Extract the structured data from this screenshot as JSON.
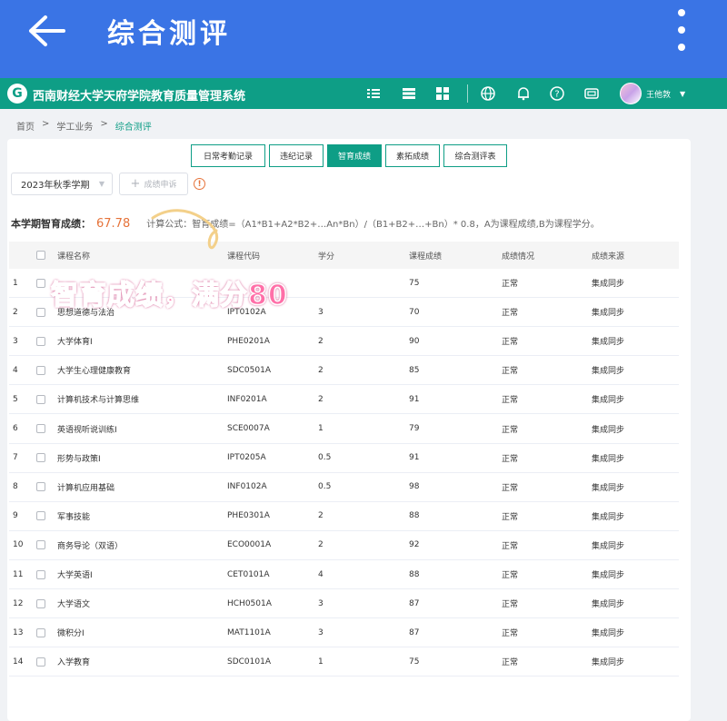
{
  "appbar": {
    "back_icon": "back-arrow-icon",
    "title": "综合测评",
    "menu_icon": "more-vertical-icon"
  },
  "header": {
    "logo_icon": "school-logo-icon",
    "system_name": "西南财经大学天府学院教育质量管理系统",
    "icons": [
      "list-indent-icon",
      "list-icon",
      "grid-icon",
      "globe-icon",
      "bell-icon",
      "help-icon",
      "badge-icon"
    ],
    "user_name": "王他敦",
    "accent_color": "#0e9e86"
  },
  "breadcrumb": {
    "home": "首页",
    "sep": ">",
    "level1": "学工业务",
    "current": "综合测评"
  },
  "tabs": [
    {
      "label": "日常考勤记录",
      "active": false
    },
    {
      "label": "违纪记录",
      "active": false
    },
    {
      "label": "智育成绩",
      "active": true
    },
    {
      "label": "素拓成绩",
      "active": false
    },
    {
      "label": "综合测评表",
      "active": false
    }
  ],
  "toolbar": {
    "semester": "2023年秋季学期",
    "apply_label": "成绩申诉",
    "apply_icon": "plus-icon",
    "info_icon": "info-icon"
  },
  "score": {
    "label": "本学期智育成绩：",
    "value": "67.78",
    "formula": "计算公式：智育成绩=（A1*B1+A2*B2+…An*Bn）/（B1+B2+…+Bn）* 0.8，A为课程成绩,B为课程学分。"
  },
  "table": {
    "columns": [
      "课程名称",
      "课程代码",
      "学分",
      "课程成绩",
      "成绩情况",
      "成绩来源"
    ],
    "rows": [
      {
        "idx": "1",
        "name": "",
        "code": "",
        "credit": "",
        "score": "75",
        "status": "正常",
        "source": "集成同步"
      },
      {
        "idx": "2",
        "name": "思想道德与法治",
        "code": "IPT0102A",
        "credit": "3",
        "score": "70",
        "status": "正常",
        "source": "集成同步"
      },
      {
        "idx": "3",
        "name": "大学体育Ⅰ",
        "code": "PHE0201A",
        "credit": "2",
        "score": "90",
        "status": "正常",
        "source": "集成同步"
      },
      {
        "idx": "4",
        "name": "大学生心理健康教育",
        "code": "SDC0501A",
        "credit": "2",
        "score": "85",
        "status": "正常",
        "source": "集成同步"
      },
      {
        "idx": "5",
        "name": "计算机技术与计算思维",
        "code": "INF0201A",
        "credit": "2",
        "score": "91",
        "status": "正常",
        "source": "集成同步"
      },
      {
        "idx": "6",
        "name": "英语视听说训练Ⅰ",
        "code": "SCE0007A",
        "credit": "1",
        "score": "79",
        "status": "正常",
        "source": "集成同步"
      },
      {
        "idx": "7",
        "name": "形势与政策Ⅰ",
        "code": "IPT0205A",
        "credit": "0.5",
        "score": "91",
        "status": "正常",
        "source": "集成同步"
      },
      {
        "idx": "8",
        "name": "计算机应用基础",
        "code": "INF0102A",
        "credit": "0.5",
        "score": "98",
        "status": "正常",
        "source": "集成同步"
      },
      {
        "idx": "9",
        "name": "军事技能",
        "code": "PHE0301A",
        "credit": "2",
        "score": "88",
        "status": "正常",
        "source": "集成同步"
      },
      {
        "idx": "10",
        "name": "商务导论（双语）",
        "code": "ECO0001A",
        "credit": "2",
        "score": "92",
        "status": "正常",
        "source": "集成同步"
      },
      {
        "idx": "11",
        "name": "大学英语Ⅰ",
        "code": "CET0101A",
        "credit": "4",
        "score": "88",
        "status": "正常",
        "source": "集成同步"
      },
      {
        "idx": "12",
        "name": "大学语文",
        "code": "HCH0501A",
        "credit": "3",
        "score": "87",
        "status": "正常",
        "source": "集成同步"
      },
      {
        "idx": "13",
        "name": "微积分Ⅰ",
        "code": "MAT1101A",
        "credit": "3",
        "score": "87",
        "status": "正常",
        "source": "集成同步"
      },
      {
        "idx": "14",
        "name": "入学教育",
        "code": "SDC0101A",
        "credit": "1",
        "score": "75",
        "status": "正常",
        "source": "集成同步"
      }
    ]
  },
  "sticker": {
    "text": "智育成绩，满分80",
    "color": "#ff6fa8"
  }
}
